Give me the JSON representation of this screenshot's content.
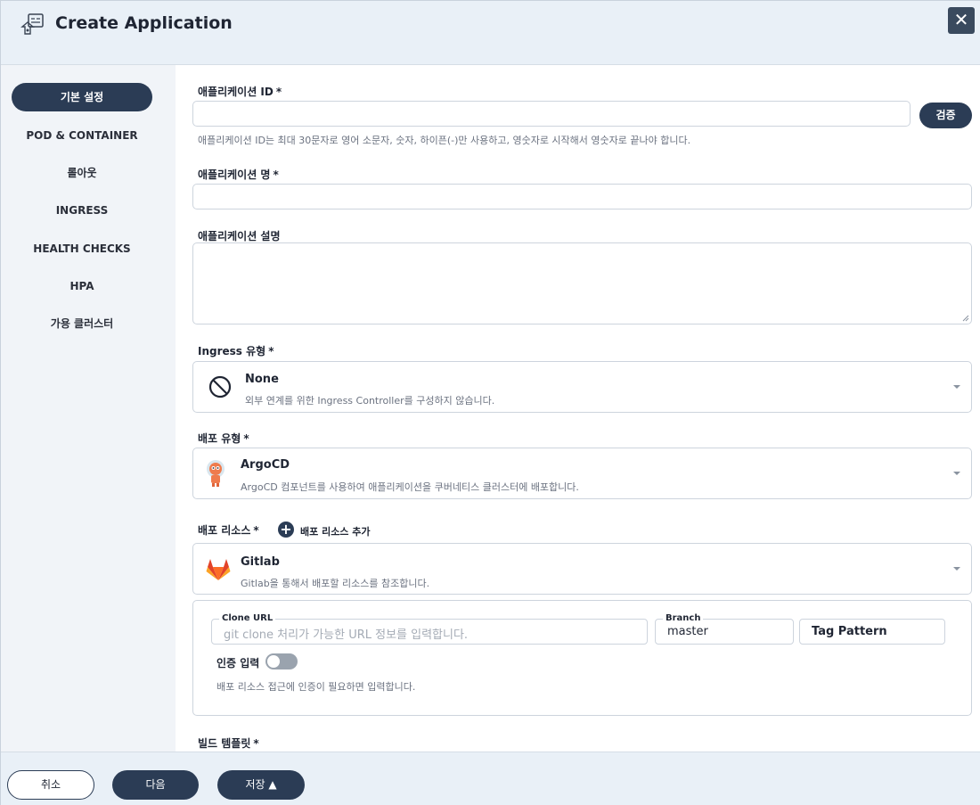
{
  "header": {
    "title": "Create Application",
    "close_label": "✕"
  },
  "sidebar": {
    "items": [
      {
        "label": "기본 설정"
      },
      {
        "label": "POD & CONTAINER"
      },
      {
        "label": "롤아웃"
      },
      {
        "label": "INGRESS"
      },
      {
        "label": "HEALTH CHECKS"
      },
      {
        "label": "HPA"
      },
      {
        "label": "가용 클러스터"
      }
    ]
  },
  "form": {
    "app_id": {
      "label": "애플리케이션 ID",
      "required": "*",
      "value": "",
      "verify_label": "검증",
      "hint": "애플리케이션 ID는 최대 30문자로 영어 소문자, 숫자, 하이픈(-)만 사용하고, 영숫자로 시작해서 영숫자로 끝나야 합니다."
    },
    "app_name": {
      "label": "애플리케이션 명",
      "required": "*",
      "value": ""
    },
    "app_desc": {
      "label": "애플리케이션 설명",
      "value": ""
    },
    "ingress_type": {
      "label": "Ingress 유형",
      "required": "*",
      "title": "None",
      "desc": "외부 연계를 위한 Ingress Controller를 구성하지 않습니다."
    },
    "deploy_type": {
      "label": "배포 유형",
      "required": "*",
      "title": "ArgoCD",
      "desc": "ArgoCD 컴포넌트를 사용하여 애플리케이션을 쿠버네티스 클러스터에 배포합니다."
    },
    "deploy_resource": {
      "label": "배포 리소스",
      "required": "*",
      "add_label": "배포 리소스 추가",
      "title": "Gitlab",
      "desc": "Gitlab을 통해서 배포할 리소스를 참조합니다.",
      "clone_url": {
        "legend": "Clone URL",
        "placeholder": "git clone 처리가 가능한 URL 정보를 입력합니다.",
        "value": ""
      },
      "branch": {
        "legend": "Branch",
        "value": "master"
      },
      "tag_pattern": {
        "placeholder": "Tag Pattern"
      },
      "auth": {
        "label": "인증 입력",
        "enabled": false,
        "hint": "배포 리소스 접근에 인증이 필요하면 입력합니다."
      }
    },
    "build_template": {
      "label": "빌드 템플릿",
      "required": "*"
    }
  },
  "footer": {
    "cancel_label": "취소",
    "next_label": "다음",
    "save_label": "저장 ▲"
  },
  "colors": {
    "primary": "#2b3c55",
    "header_bg": "#e9f0f7",
    "sidebar_bg": "#f1f4f8",
    "gitlab": "#e24329",
    "argocd": "#ef7b4d"
  }
}
